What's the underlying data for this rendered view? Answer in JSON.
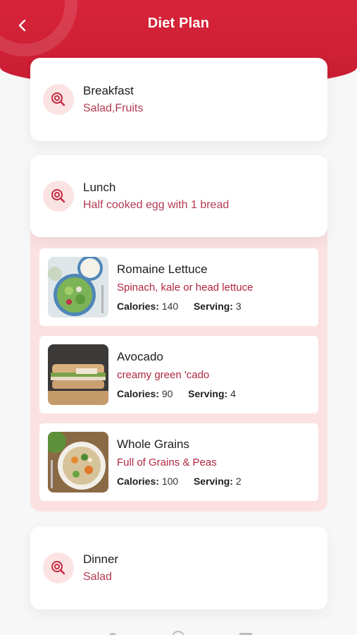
{
  "header": {
    "title": "Diet Plan"
  },
  "meals": {
    "breakfast": {
      "title": "Breakfast",
      "subtitle": "Salad,Fruits"
    },
    "lunch": {
      "title": "Lunch",
      "subtitle": "Half cooked egg with 1 bread"
    },
    "dinner": {
      "title": "Dinner",
      "subtitle": "Salad"
    }
  },
  "lunch_items": [
    {
      "name": "Romaine Lettuce",
      "desc": "Spinach, kale or head lettuce",
      "calories_label": "Calories:",
      "calories": "140",
      "serving_label": "Serving:",
      "serving": "3"
    },
    {
      "name": "Avocado",
      "desc": "creamy green 'cado",
      "calories_label": "Calories:",
      "calories": "90",
      "serving_label": "Serving:",
      "serving": "4"
    },
    {
      "name": "Whole Grains",
      "desc": "Full of Grains & Peas",
      "calories_label": "Calories:",
      "calories": "100",
      "serving_label": "Serving:",
      "serving": "2"
    }
  ],
  "colors": {
    "primary": "#d8243a",
    "accent_text": "#b0263f",
    "lunch_bg": "#fbe1e2",
    "icon_bg": "#fbe3e4"
  },
  "icons": {
    "back": "chevron-left-icon",
    "meal": "food-target-icon"
  }
}
